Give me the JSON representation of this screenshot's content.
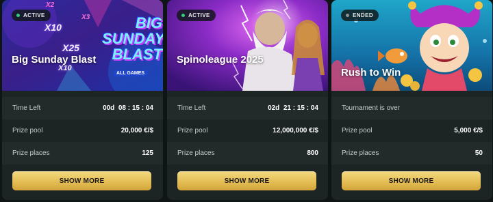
{
  "tournaments": [
    {
      "status": "ACTIVE",
      "title": "Big Sunday Blast",
      "banner_text": {
        "line1": "BIG",
        "line2": "SUNDAY",
        "line3": "BLAST",
        "sub": "ALL GAMES",
        "mult1": "X10",
        "mult2": "X25",
        "mult3": "X10",
        "mult4": "X3",
        "mult5": "X2"
      },
      "time_left_label": "Time Left",
      "time_left_value": "00d  08 : 15 : 04",
      "prize_pool_label": "Prize pool",
      "prize_pool_value": "20,000 €/$",
      "prize_places_label": "Prize places",
      "prize_places_value": "125",
      "button_label": "SHOW MORE"
    },
    {
      "status": "ACTIVE",
      "title": "Spinoleague 2025",
      "time_left_label": "Time Left",
      "time_left_value": "02d  21 : 15 : 04",
      "prize_pool_label": "Prize pool",
      "prize_pool_value": "12,000,000 €/$",
      "prize_places_label": "Prize places",
      "prize_places_value": "800",
      "button_label": "SHOW MORE"
    },
    {
      "status": "ENDED",
      "title": "Rush to Win",
      "time_left_label": "Tournament is over",
      "time_left_value": "",
      "prize_pool_label": "Prize pool",
      "prize_pool_value": "5,000 €/$",
      "prize_places_label": "Prize places",
      "prize_places_value": "50",
      "button_label": "SHOW MORE"
    }
  ],
  "colors": {
    "page_bg": "#0f1514",
    "card_bg": "#1c2424",
    "active_dot": "#2fd27a",
    "ended_dot": "#8a9493",
    "button_gold": "#e4be55"
  }
}
